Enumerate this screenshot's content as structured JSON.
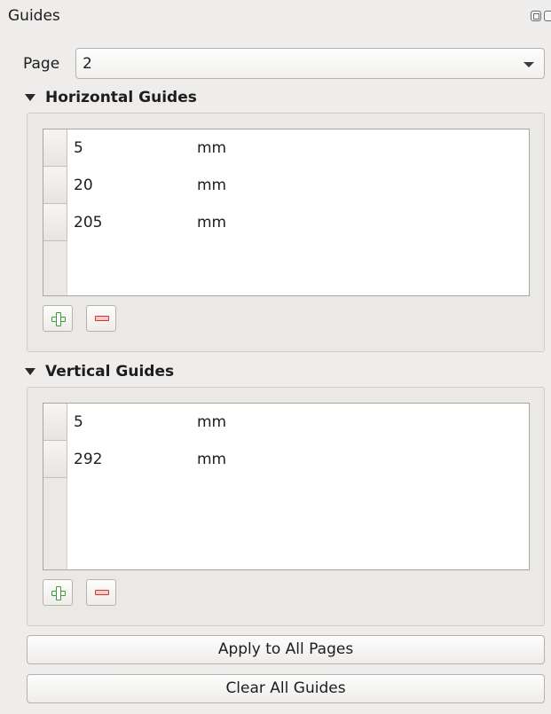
{
  "window": {
    "title": "Guides"
  },
  "page": {
    "label": "Page",
    "value": "2"
  },
  "horizontal": {
    "title": "Horizontal Guides",
    "rows": [
      {
        "value": "5",
        "unit": "mm"
      },
      {
        "value": "20",
        "unit": "mm"
      },
      {
        "value": "205",
        "unit": "mm"
      }
    ]
  },
  "vertical": {
    "title": "Vertical Guides",
    "rows": [
      {
        "value": "5",
        "unit": "mm"
      },
      {
        "value": "292",
        "unit": "mm"
      }
    ]
  },
  "buttons": {
    "apply_all": "Apply to All Pages",
    "clear_all": "Clear All Guides"
  },
  "icons": {
    "add": "add-icon",
    "remove": "remove-icon",
    "float": "float-icon",
    "close": "close-icon"
  },
  "colors": {
    "add_green": "#3f9a36",
    "remove_red": "#d03636"
  }
}
